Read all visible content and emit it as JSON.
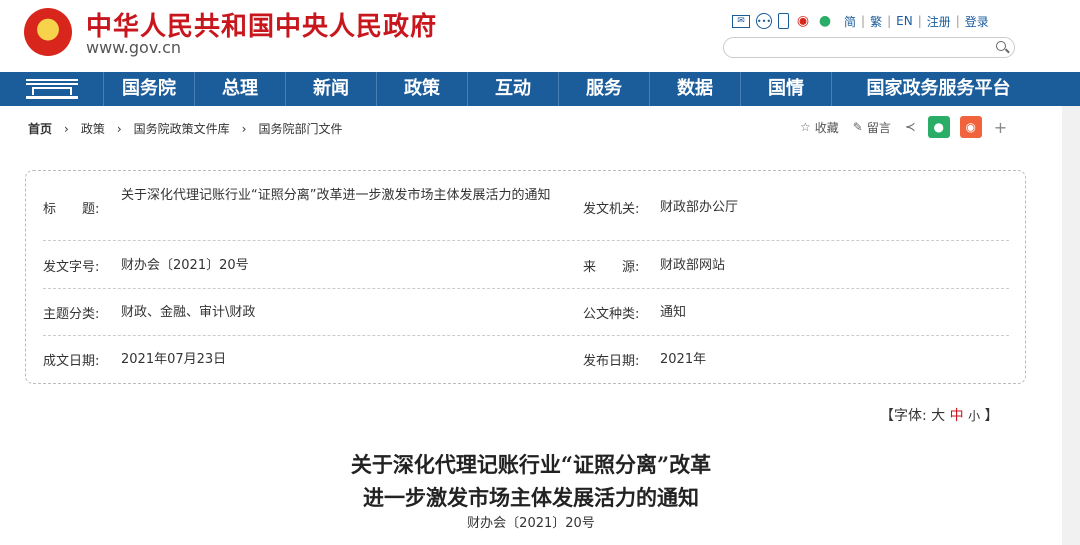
{
  "header": {
    "site_title": "中华人民共和国中央人民政府",
    "site_url": "www.gov.cn",
    "lang_links": [
      "简",
      "繁",
      "EN"
    ],
    "register": "注册",
    "login": "登录",
    "search": {
      "placeholder": ""
    }
  },
  "nav": {
    "items": [
      "国务院",
      "总理",
      "新闻",
      "政策",
      "互动",
      "服务",
      "数据",
      "国情",
      "国家政务服务平台"
    ]
  },
  "breadcrumb": [
    "首页",
    "政策",
    "国务院政策文件库",
    "国务院部门文件"
  ],
  "share": {
    "favorite": "收藏",
    "comment": "留言"
  },
  "info": {
    "title_label": "标　　题:",
    "title_value": "关于深化代理记账行业“证照分离”改革进一步激发市场主体发展活力的通知",
    "issuer_label": "发文机关:",
    "issuer_value": "财政部办公厅",
    "docno_label": "发文字号:",
    "docno_value": "财办会〔2021〕20号",
    "source_label": "来　　源:",
    "source_value": "财政部网站",
    "topic_label": "主题分类:",
    "topic_value": "财政、金融、审计\\财政",
    "type_label": "公文种类:",
    "type_value": "通知",
    "created_label": "成文日期:",
    "created_value": "2021年07月23日",
    "published_label": "发布日期:",
    "published_value": "2021年"
  },
  "font_control": {
    "prefix": "【字体:",
    "large": "大",
    "medium": "中",
    "small": "小",
    "suffix": "】"
  },
  "article": {
    "title_line1": "关于深化代理记账行业“证照分离”改革",
    "title_line2": "进一步激发市场主体发展活力的通知",
    "doc_number": "财办会〔2021〕20号"
  },
  "colors": {
    "brand_red": "#c8161d",
    "nav_blue": "#1b5c9b"
  }
}
